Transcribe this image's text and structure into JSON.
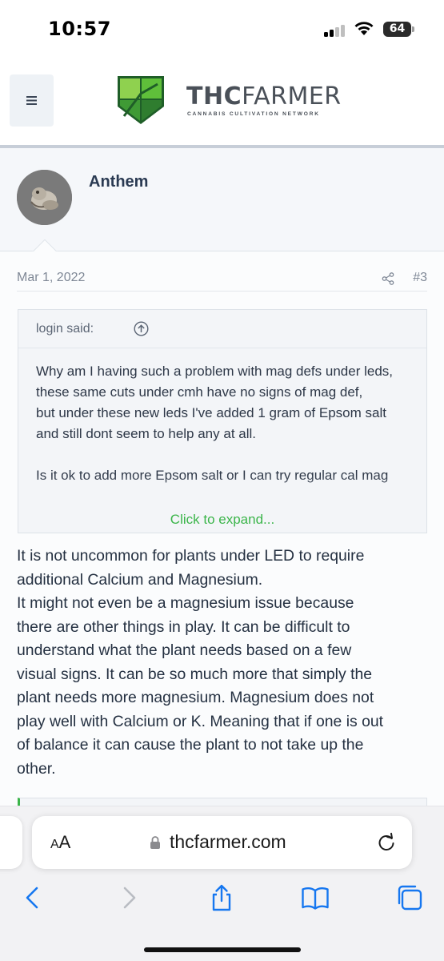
{
  "status_bar": {
    "time": "10:57",
    "battery": "64"
  },
  "header": {
    "menu_icon": "hamburger-icon",
    "logo_bold": "THC",
    "logo_light": "FARMER",
    "logo_tagline": "CANNABIS CULTIVATION NETWORK",
    "brand_colors": {
      "green": "#5fbf3a",
      "dark_green": "#2f7d2f",
      "text": "#4a5058"
    }
  },
  "post": {
    "author": "Anthem",
    "date": "Mar 1, 2022",
    "share_icon": "share-icon",
    "number": "#3",
    "quote": {
      "author": "login said:",
      "paragraphs": [
        "Why am I having such a problem with mag defs under leds, these same cuts under cmh have no signs of mag def,\nbut under these new leds I've added 1 gram of Epsom salt and still dont seem to help any at all.",
        "Is it ok to add more Epsom salt or I can try regular cal mag"
      ],
      "expand_label": "Click to expand..."
    },
    "message_lines": [
      "It is not uncommon for plants under LED to require",
      "additional Calcium and Magnesium.",
      "It might not even be a magnesium issue because",
      "there are other things in play. It can be difficult to",
      "understand what the plant needs based on a few",
      "visual signs. It can be so much more that simply the",
      "plant needs more magnesium. Magnesium does not",
      "play well with Calcium or K. Meaning that if one is out",
      "of balance it can cause the plant to not take up the",
      "other."
    ]
  },
  "browser": {
    "text_size_label": "AA",
    "url": "thcfarmer.com",
    "icons": [
      "back-icon",
      "forward-icon",
      "share-icon",
      "bookmarks-icon",
      "tabs-icon"
    ]
  }
}
